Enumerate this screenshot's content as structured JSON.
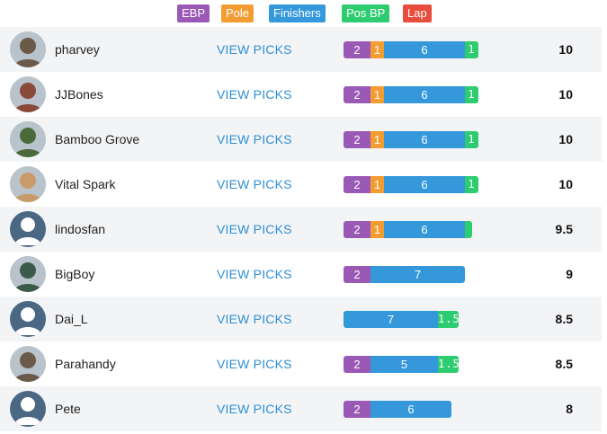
{
  "legend": [
    {
      "label": "EBP",
      "color": "#9b59b6"
    },
    {
      "label": "Pole",
      "color": "#f39c32"
    },
    {
      "label": "Finishers",
      "color": "#3498db"
    },
    {
      "label": "Pos BP",
      "color": "#2ecc71"
    },
    {
      "label": "Lap",
      "color": "#e74c3c"
    }
  ],
  "view_picks_label": "VIEW PICKS",
  "rows": [
    {
      "user": "pharvey",
      "avatar": "photo-icon",
      "score": "10",
      "segments": [
        {
          "type": "ebp",
          "value": 2,
          "label": "2"
        },
        {
          "type": "pole",
          "value": 1,
          "label": "1"
        },
        {
          "type": "finishers",
          "value": 6,
          "label": "6"
        },
        {
          "type": "posbp",
          "value": 1,
          "label": "1"
        }
      ]
    },
    {
      "user": "JJBones",
      "avatar": "photo-icon",
      "score": "10",
      "segments": [
        {
          "type": "ebp",
          "value": 2,
          "label": "2"
        },
        {
          "type": "pole",
          "value": 1,
          "label": "1"
        },
        {
          "type": "finishers",
          "value": 6,
          "label": "6"
        },
        {
          "type": "posbp",
          "value": 1,
          "label": "1"
        }
      ]
    },
    {
      "user": "Bamboo Grove",
      "avatar": "photo-icon",
      "score": "10",
      "segments": [
        {
          "type": "ebp",
          "value": 2,
          "label": "2"
        },
        {
          "type": "pole",
          "value": 1,
          "label": "1"
        },
        {
          "type": "finishers",
          "value": 6,
          "label": "6"
        },
        {
          "type": "posbp",
          "value": 1,
          "label": "1"
        }
      ]
    },
    {
      "user": "Vital Spark",
      "avatar": "photo-icon",
      "score": "10",
      "segments": [
        {
          "type": "ebp",
          "value": 2,
          "label": "2"
        },
        {
          "type": "pole",
          "value": 1,
          "label": "1"
        },
        {
          "type": "finishers",
          "value": 6,
          "label": "6"
        },
        {
          "type": "posbp",
          "value": 1,
          "label": "1"
        }
      ]
    },
    {
      "user": "lindosfan",
      "avatar": "default-user-icon",
      "score": "9.5",
      "segments": [
        {
          "type": "ebp",
          "value": 2,
          "label": "2"
        },
        {
          "type": "pole",
          "value": 1,
          "label": "1"
        },
        {
          "type": "finishers",
          "value": 6,
          "label": "6"
        },
        {
          "type": "posbp",
          "value": 0.5,
          "label": ""
        }
      ]
    },
    {
      "user": "BigBoy",
      "avatar": "photo-icon",
      "score": "9",
      "segments": [
        {
          "type": "ebp",
          "value": 2,
          "label": "2"
        },
        {
          "type": "finishers",
          "value": 7,
          "label": "7"
        }
      ]
    },
    {
      "user": "Dai_L",
      "avatar": "default-user-icon",
      "score": "8.5",
      "segments": [
        {
          "type": "finishers",
          "value": 7,
          "label": "7"
        },
        {
          "type": "posbp",
          "value": 1.5,
          "label": "1.5"
        }
      ]
    },
    {
      "user": "Parahandy",
      "avatar": "photo-icon",
      "score": "8.5",
      "segments": [
        {
          "type": "ebp",
          "value": 2,
          "label": "2"
        },
        {
          "type": "finishers",
          "value": 5,
          "label": "5"
        },
        {
          "type": "posbp",
          "value": 1.5,
          "label": "1.5"
        }
      ]
    },
    {
      "user": "Pete",
      "avatar": "default-user-icon",
      "score": "8",
      "segments": [
        {
          "type": "ebp",
          "value": 2,
          "label": "2"
        },
        {
          "type": "finishers",
          "value": 6,
          "label": "6"
        }
      ]
    }
  ],
  "segment_colors": {
    "ebp": "#9b59b6",
    "pole": "#f39c32",
    "finishers": "#3498db",
    "posbp": "#2ecc71",
    "lap": "#e74c3c"
  }
}
